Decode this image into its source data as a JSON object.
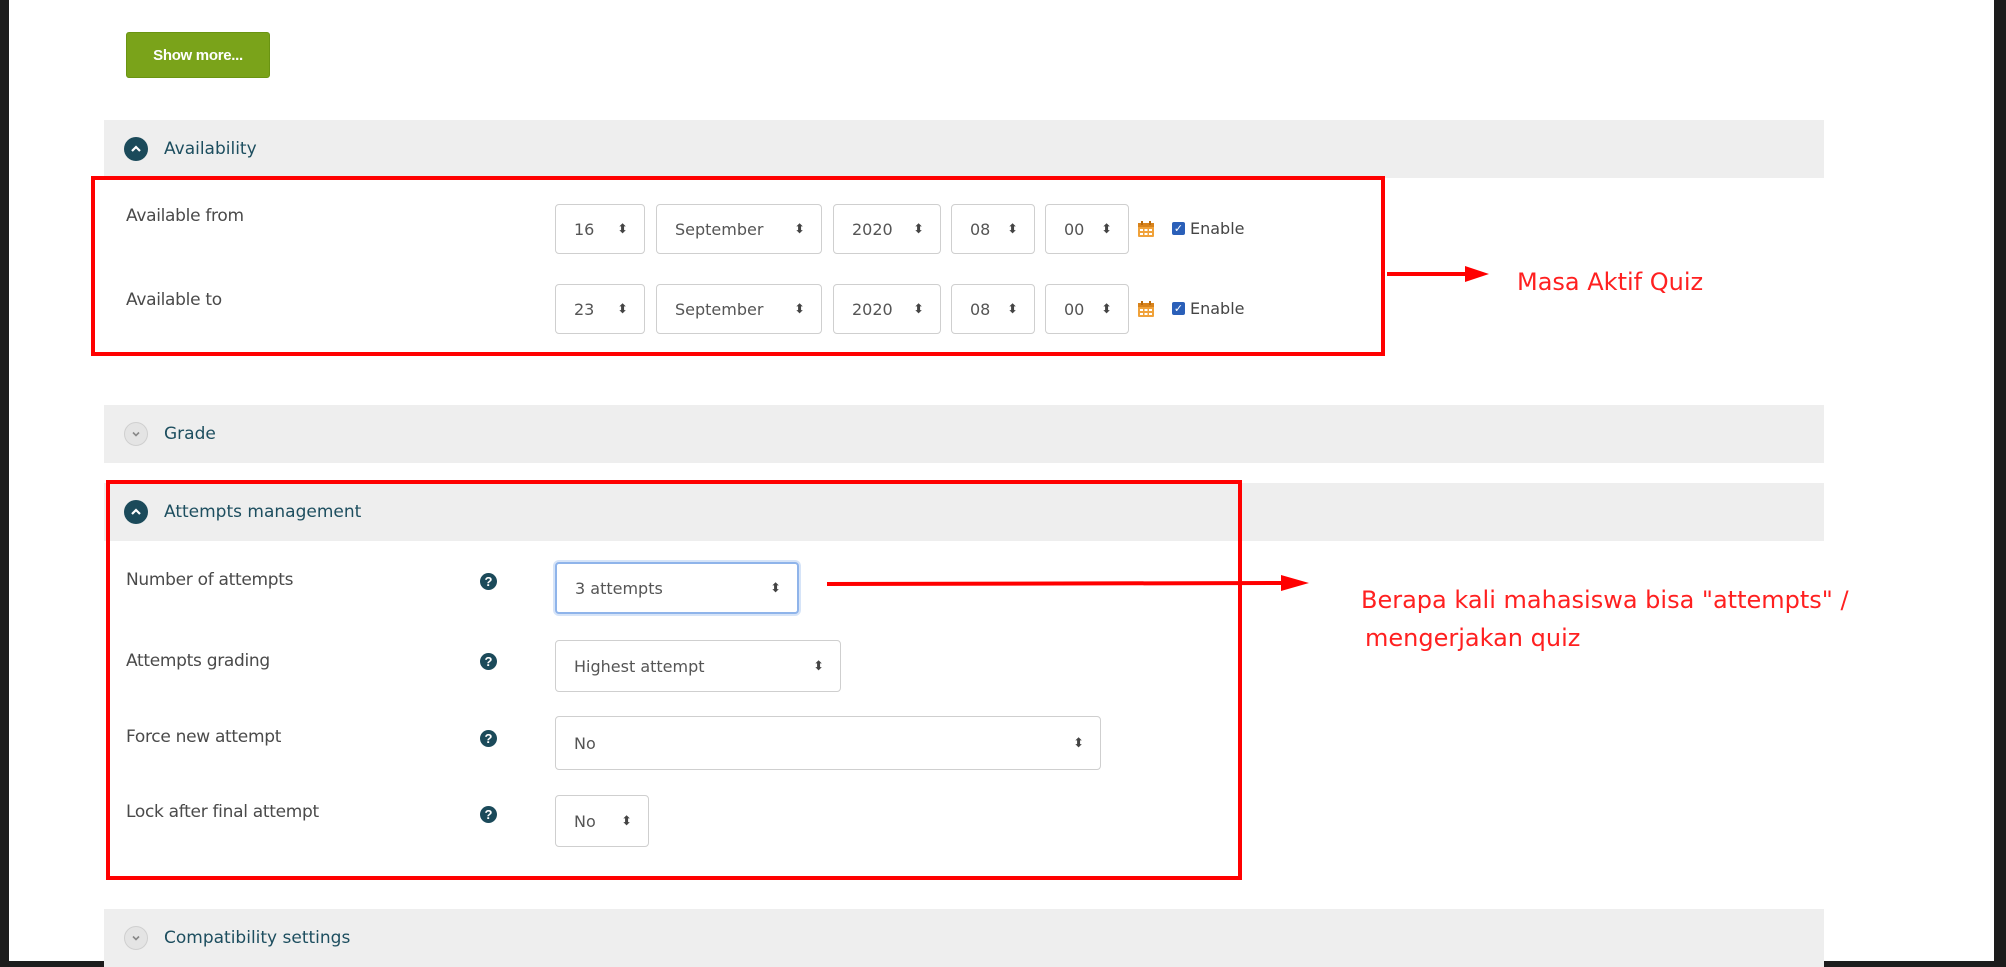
{
  "show_more": {
    "label": "Show more..."
  },
  "availability": {
    "title": "Availability",
    "rows": [
      {
        "label": "Available from",
        "day": "16",
        "month": "September",
        "year": "2020",
        "hour": "08",
        "minute": "00",
        "enable_label": "Enable",
        "enabled": true
      },
      {
        "label": "Available to",
        "day": "23",
        "month": "September",
        "year": "2020",
        "hour": "08",
        "minute": "00",
        "enable_label": "Enable",
        "enabled": true
      }
    ]
  },
  "grade": {
    "title": "Grade"
  },
  "attempts": {
    "title": "Attempts management",
    "rows": [
      {
        "label": "Number of attempts",
        "value": "3 attempts"
      },
      {
        "label": "Attempts grading",
        "value": "Highest attempt"
      },
      {
        "label": "Force new attempt",
        "value": "No"
      },
      {
        "label": "Lock after final attempt",
        "value": "No"
      }
    ]
  },
  "compatibility": {
    "title": "Compatibility settings"
  },
  "annotations": {
    "availability_note": "Masa Aktif Quiz",
    "attempts_note_line1": "Berapa kali mahasiswa bisa \"attempts\" /",
    "attempts_note_line2": "mengerjakan quiz"
  },
  "colors": {
    "accent_green": "#7aa31a",
    "annotation_red": "#ff0000",
    "section_toggle": "#1b4a5a"
  },
  "icons": [
    "chevron-up-icon",
    "chevron-down-icon",
    "calendar-icon",
    "checkbox-icon",
    "help-icon",
    "sort-caret-icon"
  ]
}
